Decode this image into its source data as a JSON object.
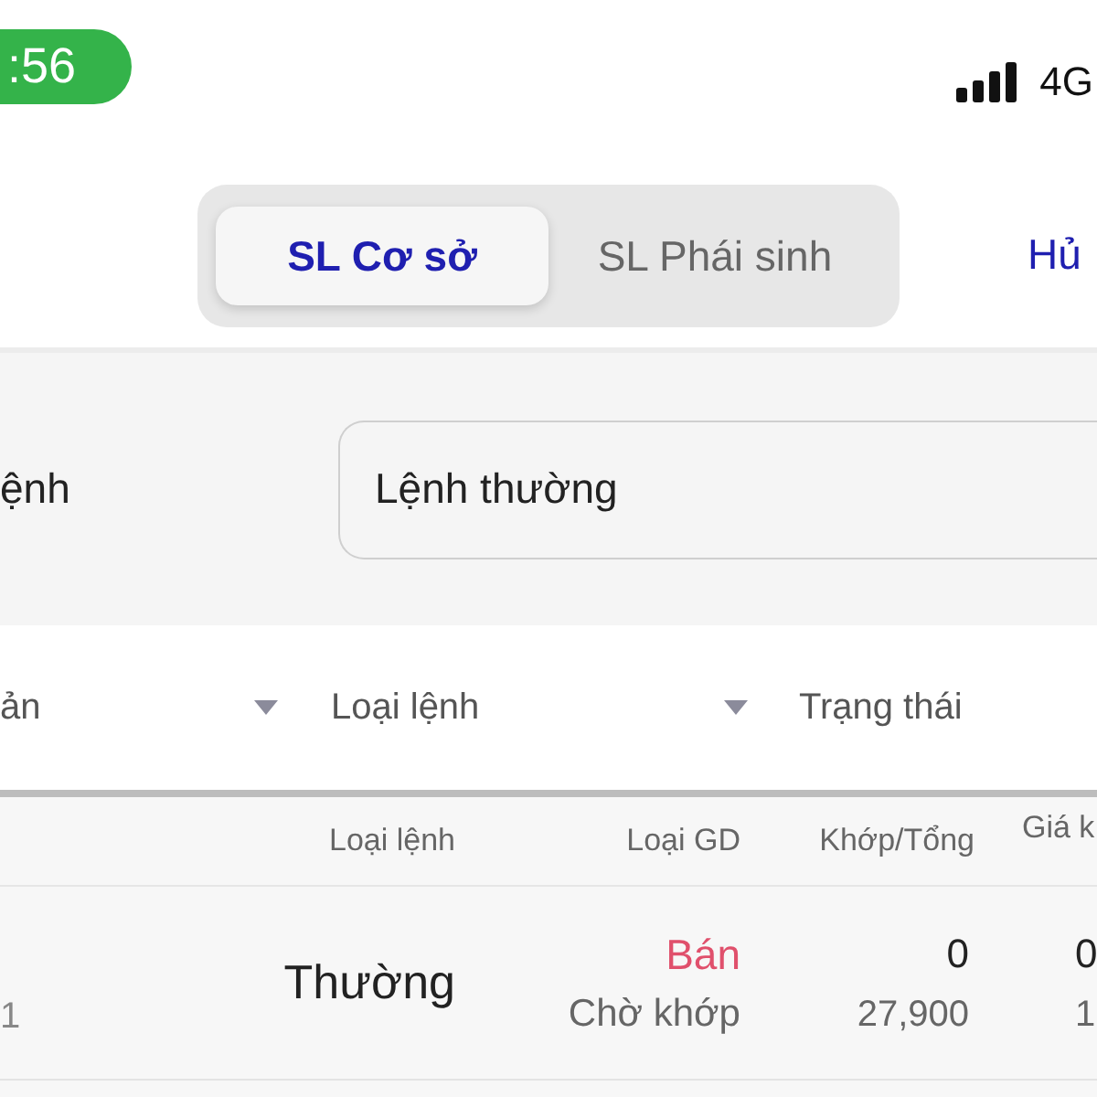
{
  "status_bar": {
    "time": ":56",
    "network": "4G"
  },
  "top_bar": {
    "segments": [
      {
        "label": "SL Cơ sở",
        "selected": true
      },
      {
        "label": "SL Phái sinh",
        "selected": false
      }
    ],
    "cancel_link": "Hủ"
  },
  "order_type_field": {
    "label": "ệnh",
    "value": "Lệnh thường"
  },
  "filters": [
    {
      "label": "ản",
      "caret": true
    },
    {
      "label": "Loại lệnh",
      "caret": true
    },
    {
      "label": "Trạng thái",
      "caret": false
    }
  ],
  "table": {
    "columns": [
      "Loại lệnh",
      "Loại GD",
      "Khớp/Tổng",
      "Giá k"
    ],
    "rows": [
      {
        "column_1": "1",
        "order_type": "Thường",
        "side": {
          "label": "Bán",
          "color": "#e0506c"
        },
        "status": "Chờ khớp",
        "matched": "0",
        "total": "27,900",
        "column_5": [
          "0",
          "1"
        ]
      }
    ]
  }
}
